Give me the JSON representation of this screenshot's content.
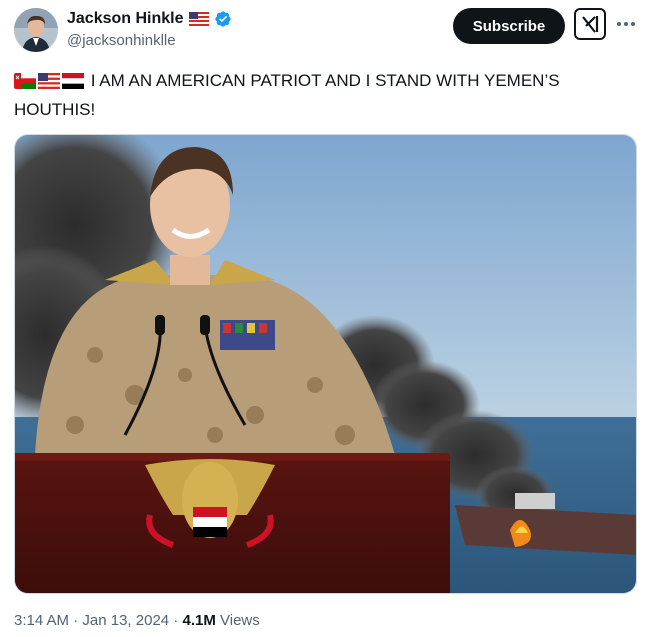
{
  "author": {
    "name": "Jackson Hinkle",
    "handle": "@jacksonhinklle",
    "verified": true,
    "name_flag": "us-flag-icon"
  },
  "actions": {
    "subscribe_label": "Subscribe",
    "grok_icon": "grok-icon",
    "more_icon": "more-icon"
  },
  "tweet": {
    "emojis": [
      "oman-flag-icon",
      "us-flag-icon",
      "yemen-flag-icon"
    ],
    "text": "I AM AN AMERICAN PATRIOT AND I STAND WITH YEMEN’S HOUTHIS!"
  },
  "media": {
    "type": "image",
    "description_icon": "tweet-photo"
  },
  "footer": {
    "time": "3:14 AM",
    "separator": "·",
    "date": "Jan 13, 2024",
    "views_count": "4.1M",
    "views_label": "Views"
  },
  "colors": {
    "subscribe_bg": "#0f1419",
    "verified_blue": "#1d9bf0",
    "secondary_text": "#536471"
  }
}
